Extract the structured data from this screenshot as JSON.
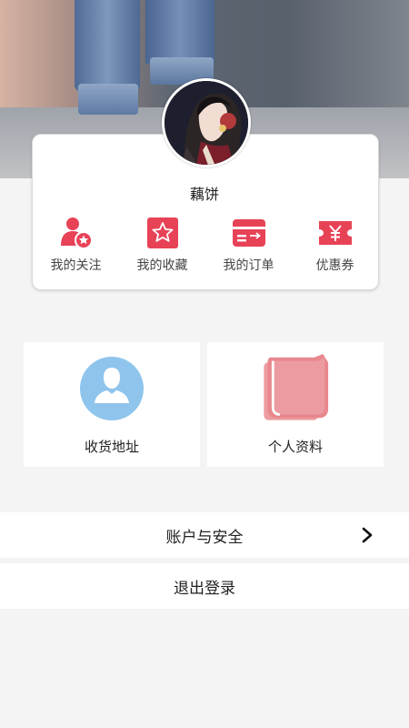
{
  "profile": {
    "username": "藕饼"
  },
  "quick_actions": [
    {
      "label": "我的关注",
      "icon": "user-star-icon"
    },
    {
      "label": "我的收藏",
      "icon": "star-square-icon"
    },
    {
      "label": "我的订单",
      "icon": "card-arrow-icon"
    },
    {
      "label": "优惠券",
      "icon": "yen-ticket-icon"
    }
  ],
  "tiles": [
    {
      "label": "收货地址",
      "icon": "user-circle-icon"
    },
    {
      "label": "个人资料",
      "icon": "folder-icon"
    }
  ],
  "menu": {
    "account_security": "账户与安全",
    "logout": "退出登录"
  },
  "colors": {
    "accent_red": "#e84257",
    "avatar_blue": "#8fc5ec",
    "folder_pink": "#ec9ca0",
    "background": "#f4f4f4"
  }
}
